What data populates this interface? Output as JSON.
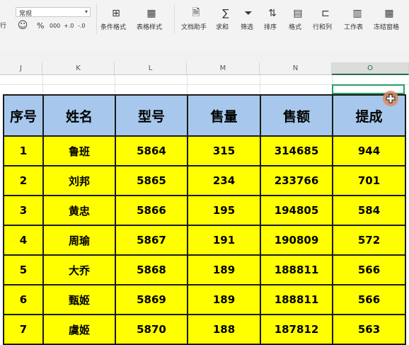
{
  "ribbon": {
    "number_format": "常规",
    "side_label": "行",
    "currency_symbol": "%",
    "thousands": "000",
    "dec_inc": "+.0",
    "dec_dec": "-.0",
    "groups": [
      {
        "label": "条件格式",
        "icon": "conditional-format-icon"
      },
      {
        "label": "表格样式",
        "icon": "table-style-icon"
      },
      {
        "label": "文档助手",
        "icon": "doc-assistant-icon"
      },
      {
        "label": "求和",
        "icon": "sum-icon"
      },
      {
        "label": "筛选",
        "icon": "filter-icon"
      },
      {
        "label": "排序",
        "icon": "sort-icon"
      },
      {
        "label": "格式",
        "icon": "format-icon"
      },
      {
        "label": "行和列",
        "icon": "rows-cols-icon"
      },
      {
        "label": "工作表",
        "icon": "worksheet-icon"
      },
      {
        "label": "冻结窗格",
        "icon": "freeze-pane-icon"
      }
    ]
  },
  "columns": [
    "J",
    "K",
    "L",
    "M",
    "N",
    "O"
  ],
  "table": {
    "headers": [
      "序号",
      "姓名",
      "型号",
      "售量",
      "售额",
      "提成"
    ],
    "rows": [
      [
        "1",
        "鲁班",
        "5864",
        "315",
        "314685",
        "944"
      ],
      [
        "2",
        "刘邦",
        "5865",
        "234",
        "233766",
        "701"
      ],
      [
        "3",
        "黄忠",
        "5866",
        "195",
        "194805",
        "584"
      ],
      [
        "4",
        "周瑜",
        "5867",
        "191",
        "190809",
        "572"
      ],
      [
        "5",
        "大乔",
        "5868",
        "189",
        "188811",
        "566"
      ],
      [
        "6",
        "甄姬",
        "5869",
        "189",
        "188811",
        "566"
      ],
      [
        "7",
        "虞姬",
        "5870",
        "188",
        "187812",
        "563"
      ]
    ]
  },
  "colors": {
    "header_fill": "#a7c8ec",
    "body_fill": "#ffff00",
    "selection": "#21a366"
  }
}
